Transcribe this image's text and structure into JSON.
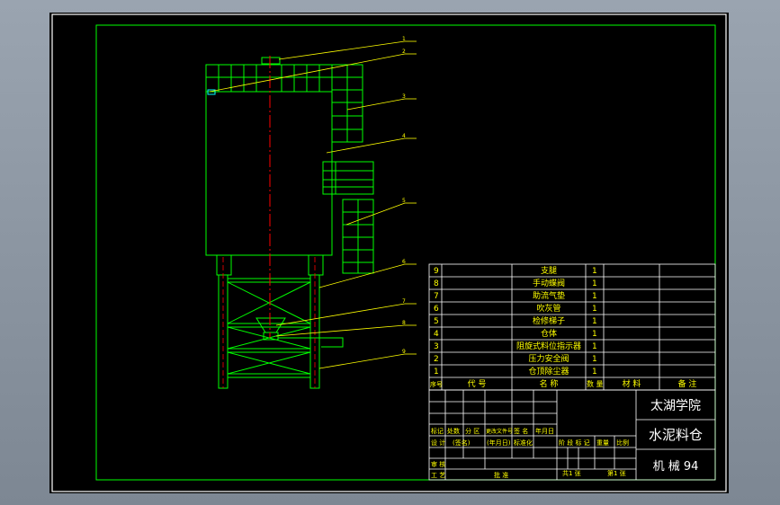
{
  "parts_list": {
    "header": {
      "seq": "序号",
      "code": "代 号",
      "name": "名 称",
      "qty": "数 量",
      "material": "材 料",
      "remarks": "备 注"
    },
    "rows": [
      {
        "seq": "9",
        "name": "支腿",
        "qty": "1"
      },
      {
        "seq": "8",
        "name": "手动蝶阀",
        "qty": "1"
      },
      {
        "seq": "7",
        "name": "助流气垫",
        "qty": "1"
      },
      {
        "seq": "6",
        "name": "吹灰管",
        "qty": "1"
      },
      {
        "seq": "5",
        "name": "检修梯子",
        "qty": "1"
      },
      {
        "seq": "4",
        "name": "仓体",
        "qty": "1"
      },
      {
        "seq": "3",
        "name": "阻旋式料位指示器",
        "qty": "1"
      },
      {
        "seq": "2",
        "name": "压力安全阀",
        "qty": "1"
      },
      {
        "seq": "1",
        "name": "仓顶除尘器",
        "qty": "1"
      }
    ]
  },
  "title_block": {
    "school": "太湖学院",
    "drawing_title": "水泥料仓",
    "class_id": "机 械 94",
    "revision_headers": [
      "标记",
      "处数",
      "分 区",
      "更改文件号",
      "签 名",
      "年月日"
    ],
    "design_row": [
      "设 计",
      "(签名)",
      "(年月日)",
      "标准化"
    ],
    "stage_headers": [
      "阶 段 标 记",
      "重量",
      "比例"
    ],
    "review_label": "审 核",
    "process_label": "工 艺",
    "approve_label": "批 准",
    "sheet_total": "共1 张",
    "sheet_no": "第1 张"
  },
  "balloons": [
    "1",
    "2",
    "3",
    "4",
    "5",
    "6",
    "7",
    "8",
    "9"
  ],
  "colors": {
    "background": "#000000",
    "frame": "#00ff00",
    "table_lines": "#ffffff",
    "table_text": "#ffff00",
    "leader_lines": "#ffff00",
    "centerline": "#ff0000",
    "cyan_part": "#00ffff",
    "title_text": "#ffffff"
  }
}
